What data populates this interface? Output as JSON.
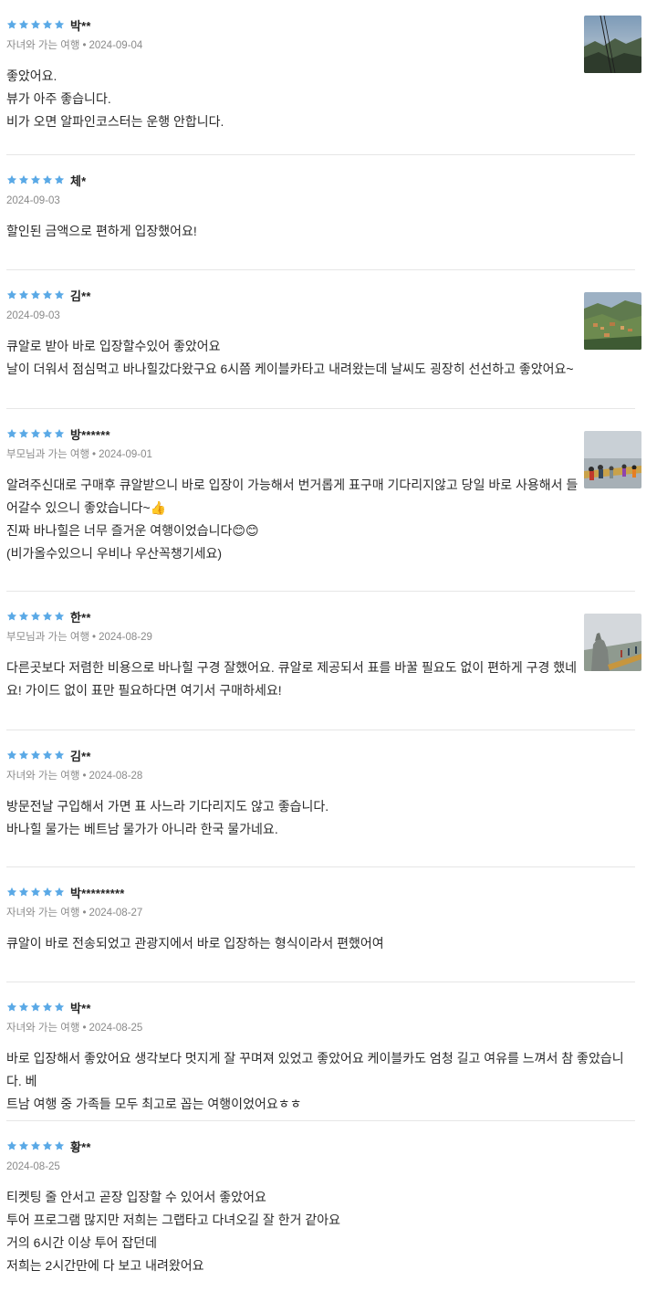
{
  "colors": {
    "star": "#5aa9e6",
    "meta": "#8a8a8a",
    "divider": "#e6e6e6"
  },
  "reviews": [
    {
      "rating": 5,
      "name": "박**",
      "trip_type": "자녀와 가는 여행",
      "date": "2024-09-04",
      "has_photo": true,
      "photo": "mountain-cablecar",
      "lines": [
        "좋았어요.",
        "뷰가 아주 좋습니다.",
        "비가 오면 알파인코스터는 운행 안합니다."
      ]
    },
    {
      "rating": 5,
      "name": "체*",
      "trip_type": "",
      "date": "2024-09-03",
      "has_photo": false,
      "lines": [
        "할인된 금액으로 편하게 입장했어요!"
      ]
    },
    {
      "rating": 5,
      "name": "김**",
      "trip_type": "",
      "date": "2024-09-03",
      "has_photo": true,
      "photo": "village-valley",
      "lines": [
        "큐알로 받아 바로 입장할수있어 좋았어요",
        "날이 더워서 점심먹고 바나힐갔다왔구요 6시쯤 케이블카타고 내려왔는데 날씨도 굉장히 선선하고 좋았어요~"
      ]
    },
    {
      "rating": 5,
      "name": "방******",
      "trip_type": "부모님과 가는 여행",
      "date": "2024-09-01",
      "has_photo": true,
      "photo": "golden-bridge-crowd",
      "lines": [
        "알려주신대로 구매후 큐알받으니 바로 입장이 가능해서 번거롭게 표구매 기다리지않고 당일 바로 사용해서 들",
        "어갈수 있으니 좋았습니다~👍",
        "진짜 바나힐은 너무 즐거운 여행이었습니다😊😊",
        "(비가올수있으니 우비나 우산꼭챙기세요)"
      ]
    },
    {
      "rating": 5,
      "name": "한**",
      "trip_type": "부모님과 가는 여행",
      "date": "2024-08-29",
      "has_photo": true,
      "photo": "stone-hands",
      "lines": [
        "다른곳보다 저렴한 비용으로 바나힐 구경 잘했어요. 큐알로 제공되서 표를 바꿀 필요도 없이 편하게 구경 했네",
        "요! 가이드 없이 표만 필요하다면 여기서 구매하세요!"
      ]
    },
    {
      "rating": 5,
      "name": "김**",
      "trip_type": "자녀와 가는 여행",
      "date": "2024-08-28",
      "has_photo": false,
      "lines": [
        "방문전날 구입해서 가면 표 사느라 기다리지도 않고 좋습니다.",
        "바나힐 물가는 베트남 물가가 아니라 한국 물가네요."
      ]
    },
    {
      "rating": 5,
      "name": "박*********",
      "trip_type": "자녀와 가는 여행",
      "date": "2024-08-27",
      "has_photo": false,
      "lines": [
        "큐알이 바로 전송되었고 관광지에서 바로 입장하는 형식이라서 편했어여"
      ]
    },
    {
      "rating": 5,
      "name": "박**",
      "trip_type": "자녀와 가는 여행",
      "date": "2024-08-25",
      "has_photo": false,
      "lines": [
        "바로 입장해서 좋았어요 생각보다 멋지게 잘 꾸며져 있었고 좋았어요 케이블카도 엄청 길고 여유를 느껴서 참 좋았습니다. 베",
        "트남 여행 중 가족들 모두 최고로 꼽는 여행이었어요ㅎㅎ"
      ]
    },
    {
      "rating": 5,
      "name": "황**",
      "trip_type": "",
      "date": "2024-08-25",
      "has_photo": false,
      "lines": [
        "티켓팅 줄 안서고 곧장 입장할 수 있어서 좋았어요",
        "투어 프로그램 많지만 저희는 그랩타고 다녀오길 잘 한거 같아요",
        "거의 6시간 이상 투어 잡던데",
        "저희는 2시간만에 다 보고 내려왔어요"
      ]
    }
  ]
}
